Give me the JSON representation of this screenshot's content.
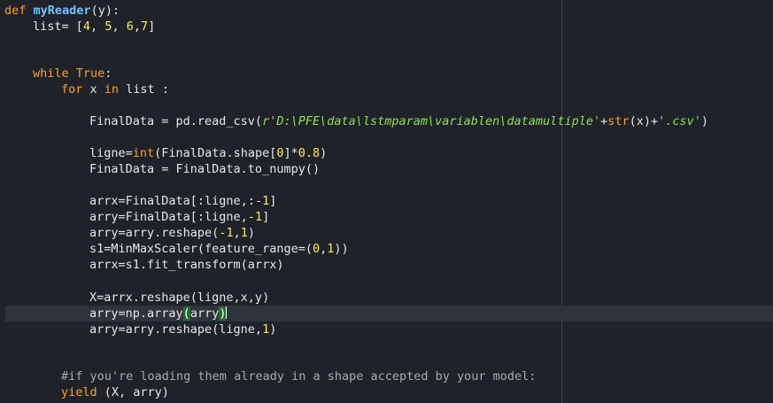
{
  "editor": {
    "lines": {
      "def_line": {
        "kw": "def",
        "name": "myReader",
        "args": "(y):"
      },
      "list_line": {
        "a": "list= [",
        "n1": "4",
        "c1": ", ",
        "n2": "5",
        "c2": ", ",
        "n3": "6",
        "c3": ",",
        "n4": "7",
        "end": "]"
      },
      "while_line": {
        "kw": "while",
        "sp": " ",
        "val": "True",
        "colon": ":"
      },
      "for_line": {
        "kw1": "for",
        "a": " x ",
        "kw2": "in",
        "b": " list :"
      },
      "finaldata_line": {
        "a": "FinalData = pd.read_csv(",
        "str1": "r'D:\\PFE\\data\\lstmparam\\variablen\\datamultiple'",
        "b": "+",
        "fn": "str",
        "c": "(x)+",
        "str2": "'.csv'",
        "d": ")"
      },
      "ligne_line": {
        "a": "ligne=",
        "fn": "int",
        "b": "(FinalData.shape[",
        "n1": "0",
        "c": "]*",
        "n2": "0.8",
        "d": ")"
      },
      "tonumpy_line": {
        "text": "FinalData = FinalData.to_numpy()"
      },
      "arrx_line": {
        "a": "arrx=FinalData[:ligne,:",
        "n": "-1",
        "b": "]"
      },
      "arry_line": {
        "a": "arry=FinalData[:ligne,",
        "n": "-1",
        "b": "]"
      },
      "reshape_line": {
        "a": "arry=arry.reshape(",
        "n1": "-1",
        "c": ",",
        "n2": "1",
        "b": ")"
      },
      "scaler_line": {
        "a": "s1=MinMaxScaler(feature_range=(",
        "n1": "0",
        "c": ",",
        "n2": "1",
        "b": "))"
      },
      "fit_line": {
        "text": "arrx=s1.fit_transform(arrx)"
      },
      "x_line": {
        "text": "X=arrx.reshape(ligne,x,y)"
      },
      "nparray_line": {
        "a": "arry=np.array",
        "open": "(",
        "arg": "arry",
        "close": ")"
      },
      "reshape2_line": {
        "a": "arry=arry.reshape(ligne,",
        "n": "1",
        "b": ")"
      },
      "comment_line": {
        "text": "#if you're loading them already in a shape accepted by your model:"
      },
      "yield_line": {
        "kw": "yield",
        "rest": " (X, arry)"
      }
    }
  }
}
